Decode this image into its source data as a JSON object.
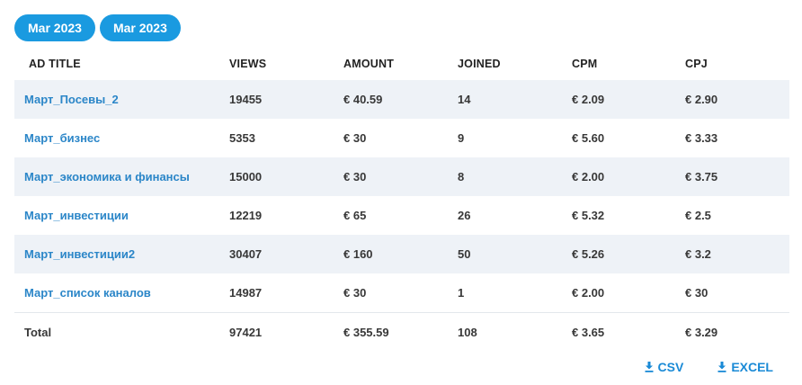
{
  "filters": {
    "pill_1": "Mar 2023",
    "pill_2": "Mar 2023"
  },
  "table": {
    "columns": [
      "AD TITLE",
      "VIEWS",
      "AMOUNT",
      "JOINED",
      "CPM",
      "CPJ"
    ],
    "rows": [
      {
        "title": "Март_Посевы_2",
        "views": "19455",
        "amount": "€ 40.59",
        "joined": "14",
        "cpm": "€ 2.09",
        "cpj": "€ 2.90"
      },
      {
        "title": "Март_бизнес",
        "views": "5353",
        "amount": "€ 30",
        "joined": "9",
        "cpm": "€ 5.60",
        "cpj": "€ 3.33"
      },
      {
        "title": "Март_экономика и финансы",
        "views": "15000",
        "amount": "€ 30",
        "joined": "8",
        "cpm": "€ 2.00",
        "cpj": "€ 3.75"
      },
      {
        "title": "Март_инвестиции",
        "views": "12219",
        "amount": "€ 65",
        "joined": "26",
        "cpm": "€ 5.32",
        "cpj": "€ 2.5"
      },
      {
        "title": "Март_инвестиции2",
        "views": "30407",
        "amount": "€ 160",
        "joined": "50",
        "cpm": "€ 5.26",
        "cpj": "€ 3.2"
      },
      {
        "title": "Март_список каналов",
        "views": "14987",
        "amount": "€ 30",
        "joined": "1",
        "cpm": "€ 2.00",
        "cpj": "€ 30"
      }
    ],
    "total": {
      "label": "Total",
      "views": "97421",
      "amount": "€ 355.59",
      "joined": "108",
      "cpm": "€ 3.65",
      "cpj": "€ 3.29"
    }
  },
  "export": {
    "csv_label": "CSV",
    "excel_label": "EXCEL",
    "icon": "download-icon"
  },
  "colors": {
    "accent": "#1a9ae0",
    "link": "#2b86c8",
    "row_shade": "#eef2f7"
  }
}
